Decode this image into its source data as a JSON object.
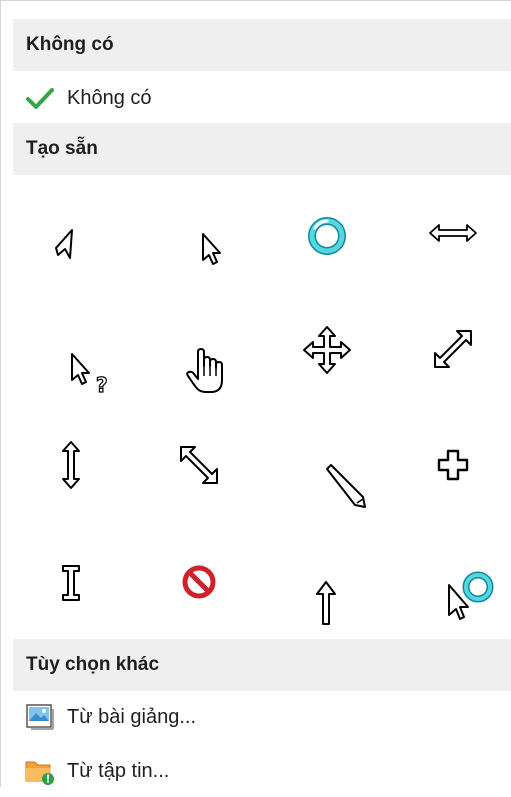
{
  "sections": {
    "none_header": "Không có",
    "preset_header": "Tạo sẵn",
    "other_header": "Tùy chọn khác"
  },
  "none_item": {
    "label": "Không có",
    "icon": "checkmark-icon",
    "selected": true
  },
  "presets": [
    "arrow-pointer-icon",
    "arrow-pointer-small-icon",
    "busy-ring-icon",
    "horizontal-resize-icon",
    "help-select-icon",
    "hand-pointer-icon",
    "move-icon",
    "diagonal-resize-ne-icon",
    "vertical-resize-icon",
    "diagonal-resize-nw-icon",
    "pen-icon",
    "precision-cross-icon",
    "text-beam-icon",
    "unavailable-icon",
    "up-arrow-icon",
    "working-in-background-icon"
  ],
  "other_options": [
    {
      "label": "Từ bài giảng...",
      "icon": "image-file-icon"
    },
    {
      "label": "Từ tập tin...",
      "icon": "folder-icon"
    }
  ],
  "colors": {
    "header_bg": "#efefef",
    "check_green": "#3aa34a",
    "busy_teal": "#34b9c9",
    "no_red": "#d0202a",
    "folder_orange": "#f2a03a"
  }
}
